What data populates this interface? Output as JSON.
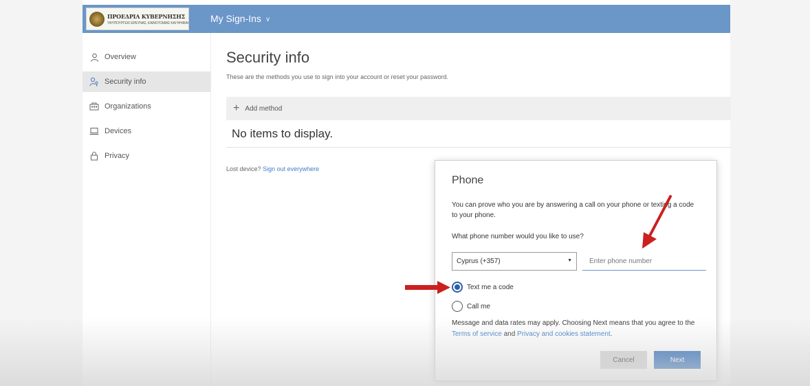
{
  "header": {
    "logo_line1": "ΠΡΟΕΔΡΙΑ ΚΥΒΕΡΝΗΣΗΣ",
    "logo_line2": "ΥΦΥΠΟΥΡΓΕΙΟ ΕΡΕΥΝΑΣ, ΚΑΙΝΟΤΟΜΙΑΣ ΚΑΙ ΨΗΦΙΑΚΗΣ ΠΟΛΙΤΙΚΗΣ",
    "app_title": "My Sign-Ins",
    "accent_color": "#6a96c8"
  },
  "sidebar": {
    "items": [
      {
        "label": "Overview",
        "icon": "person-icon"
      },
      {
        "label": "Security info",
        "icon": "person-key-icon"
      },
      {
        "label": "Organizations",
        "icon": "building-icon"
      },
      {
        "label": "Devices",
        "icon": "laptop-icon"
      },
      {
        "label": "Privacy",
        "icon": "lock-icon"
      }
    ],
    "active_index": 1
  },
  "main": {
    "title": "Security info",
    "subtitle": "These are the methods you use to sign into your account or reset your password.",
    "add_method": "Add method",
    "empty_text": "No items to display.",
    "lost_device": "Lost device?",
    "sign_out_link": "Sign out everywhere"
  },
  "dialog": {
    "title": "Phone",
    "description": "You can prove who you are by answering a call on your phone or texting a code to your phone.",
    "question": "What phone number would you like to use?",
    "country": "Cyprus (+357)",
    "phone_placeholder": "Enter phone number",
    "phone_value": "",
    "options": [
      {
        "label": "Text me a code",
        "checked": true
      },
      {
        "label": "Call me",
        "checked": false
      }
    ],
    "note_prefix": "Message and data rates may apply. Choosing Next means that you agree to the",
    "terms_link": "Terms of service",
    "note_and": "and",
    "privacy_link": "Privacy and cookies statement",
    "note_end": ".",
    "cancel": "Cancel",
    "next": "Next",
    "primary_color": "#2f6dba"
  },
  "annotation_color": "#cc1f1f"
}
